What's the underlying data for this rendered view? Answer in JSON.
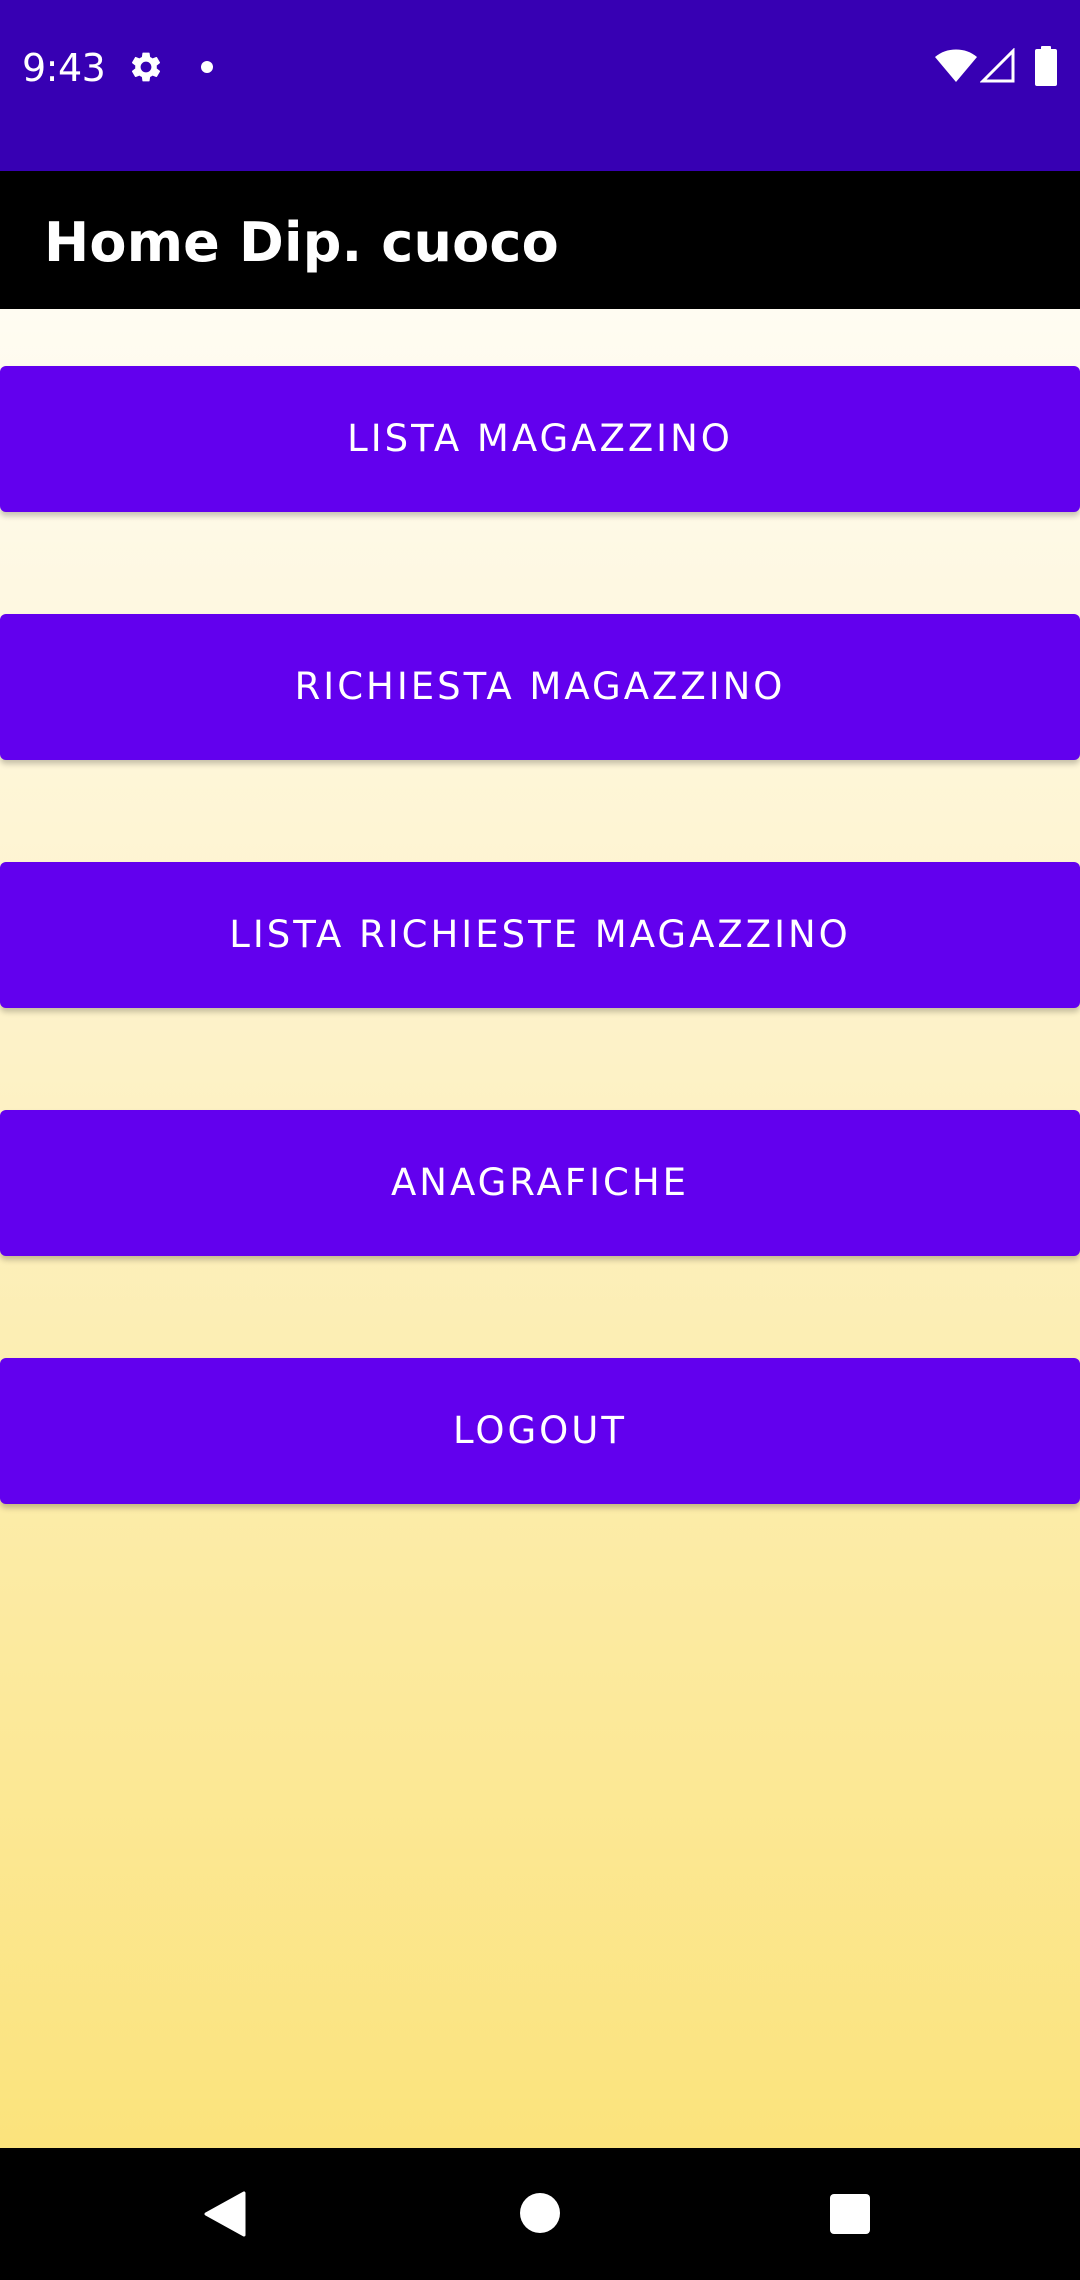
{
  "status_bar": {
    "time": "9:43",
    "icons": [
      "gear-icon",
      "notification-dot-icon",
      "wifi-icon",
      "cellular-signal-icon",
      "battery-icon"
    ],
    "background_color": "#3700B3"
  },
  "app_bar": {
    "title": "Home Dip. cuoco",
    "background_color": "#000000"
  },
  "menu": {
    "button_color": "#6200EE",
    "buttons": [
      {
        "label": "LISTA MAGAZZINO"
      },
      {
        "label": "RICHIESTA MAGAZZINO"
      },
      {
        "label": "LISTA RICHIESTE MAGAZZINO"
      },
      {
        "label": "ANAGRAFICHE"
      },
      {
        "label": "LOGOUT"
      }
    ]
  },
  "nav_bar": {
    "icons": [
      "back-icon",
      "home-icon",
      "recents-icon"
    ]
  }
}
